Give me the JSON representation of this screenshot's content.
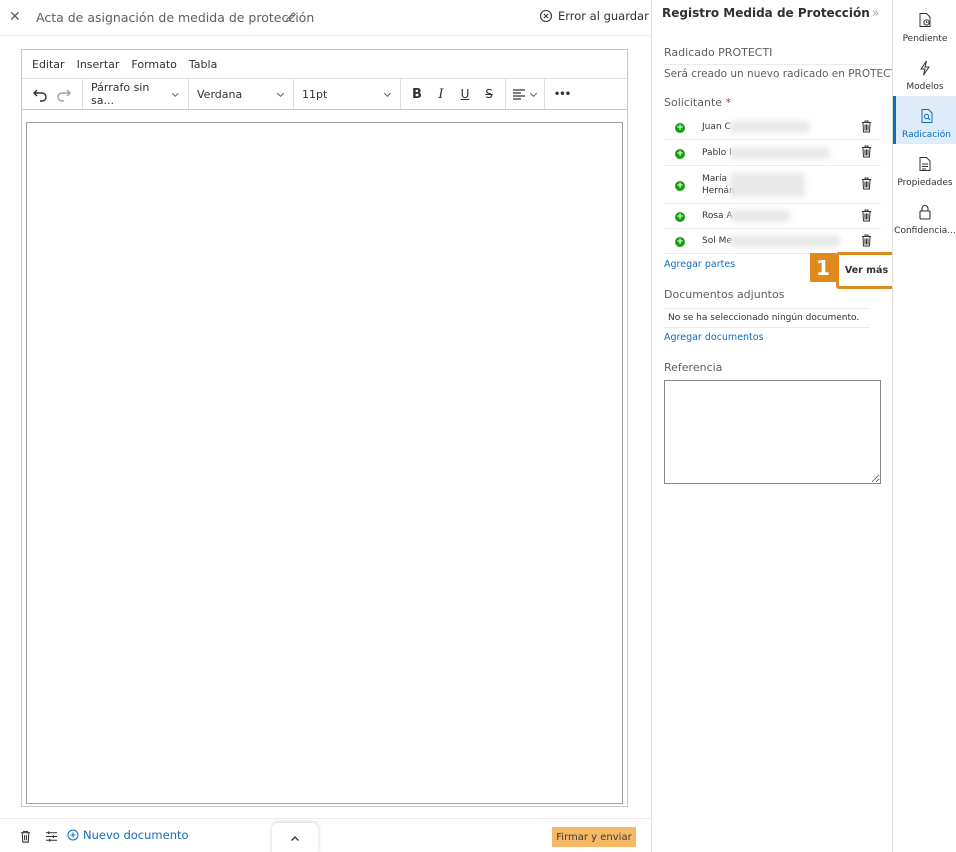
{
  "header": {
    "close_icon": "close-icon",
    "doc_title": "Acta de asignación de medida de protección",
    "edit_icon": "pencil-icon",
    "error_label": "Error al guardar"
  },
  "editor": {
    "menu": [
      "Editar",
      "Insertar",
      "Formato",
      "Tabla"
    ],
    "paragraph_style": "Párrafo sin sa...",
    "font_family": "Verdana",
    "font_size": "11pt",
    "more_label": "•••"
  },
  "footer": {
    "new_document": "Nuevo documento",
    "sign_send": "Firmar y enviar"
  },
  "panel": {
    "title": "Registro Medida de Protección",
    "collapse_glyph": "»",
    "radicado_label": "Radicado PROTECTI",
    "radicado_value": "Será creado un nuevo radicado en PROTECTI",
    "solicitante_label": "Solicitante",
    "required_mark": "*",
    "parties": [
      {
        "name": "Juan C"
      },
      {
        "name": "Pablo I"
      },
      {
        "name": "María\nHernán"
      },
      {
        "name": "Rosa A"
      },
      {
        "name": "Sol Me"
      }
    ],
    "add_parties": "Agregar partes",
    "see_more": "Ver más",
    "callout_number": "1",
    "attachments_label": "Documentos adjuntos",
    "no_document": "No se ha seleccionado ningún documento.",
    "add_documents": "Agregar documentos",
    "reference_label": "Referencia"
  },
  "rail": [
    {
      "label": "Pendiente",
      "icon": "pending-document-icon",
      "active": false
    },
    {
      "label": "Modelos",
      "icon": "flash-icon",
      "active": false
    },
    {
      "label": "Radicación",
      "icon": "document-search-icon",
      "active": true
    },
    {
      "label": "Propiedades",
      "icon": "document-properties-icon",
      "active": false
    },
    {
      "label": "Confidencia...",
      "icon": "lock-icon",
      "active": false
    }
  ],
  "colors": {
    "accent": "#0f6cbd",
    "callout": "#e08a1e",
    "sign_button": "#f4b867",
    "add_green": "#13a10e",
    "required": "#c4314b"
  }
}
